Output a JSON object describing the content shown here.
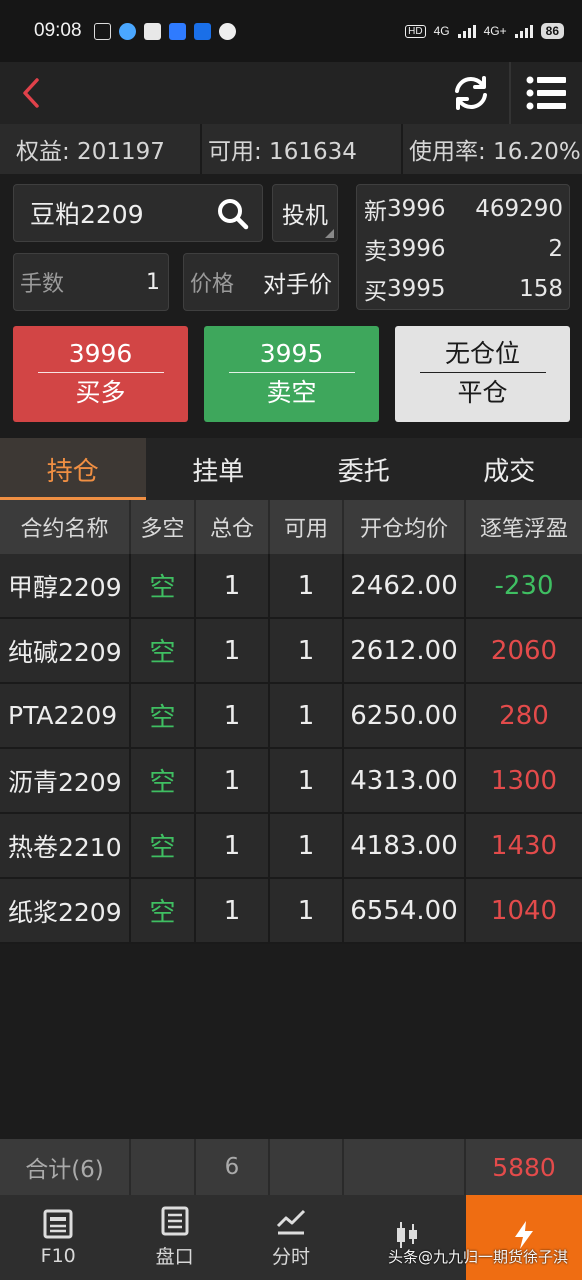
{
  "statusbar": {
    "time": "09:08",
    "battery": "86",
    "net1": "4G",
    "net2": "4G+"
  },
  "account": {
    "equity": "权益: 201197",
    "available": "可用: 161634",
    "usage": "使用率: 16.20%"
  },
  "order": {
    "symbol": "豆粕2209",
    "mode": "投机",
    "qty_label": "手数",
    "qty_value": "1",
    "price_label": "价格",
    "price_value": "对手价"
  },
  "quote": {
    "last_label": "新",
    "last_price": "3996",
    "volume": "469290",
    "ask_label": "卖",
    "ask_price": "3996",
    "ask_vol": "2",
    "bid_label": "买",
    "bid_price": "3995",
    "bid_vol": "158"
  },
  "buttons": {
    "buy_price": "3996",
    "buy_label": "买多",
    "sell_price": "3995",
    "sell_label": "卖空",
    "close_top": "无仓位",
    "close_label": "平仓"
  },
  "tabs": [
    "持仓",
    "挂单",
    "委托",
    "成交"
  ],
  "table": {
    "headers": [
      "合约名称",
      "多空",
      "总仓",
      "可用",
      "开仓均价",
      "逐笔浮盈"
    ],
    "rows": [
      [
        "甲醇2209",
        "空",
        "1",
        "1",
        "2462.00",
        "-230"
      ],
      [
        "纯碱2209",
        "空",
        "1",
        "1",
        "2612.00",
        "2060"
      ],
      [
        "PTA2209",
        "空",
        "1",
        "1",
        "6250.00",
        "280"
      ],
      [
        "沥青2209",
        "空",
        "1",
        "1",
        "4313.00",
        "1300"
      ],
      [
        "热卷2210",
        "空",
        "1",
        "1",
        "4183.00",
        "1430"
      ],
      [
        "纸浆2209",
        "空",
        "1",
        "1",
        "6554.00",
        "1040"
      ]
    ],
    "total_label": "合计(6)",
    "total_qty": "6",
    "total_pnl": "5880"
  },
  "bottomnav": [
    "F10",
    "盘口",
    "分时",
    "",
    ""
  ],
  "watermark": "头条@九九归一期货徐子淇",
  "colors": {
    "accent": "#ef6d12",
    "up": "#e34b4b",
    "down": "#3fbf62",
    "buy": "#d24545",
    "sell": "#3ea75c"
  }
}
